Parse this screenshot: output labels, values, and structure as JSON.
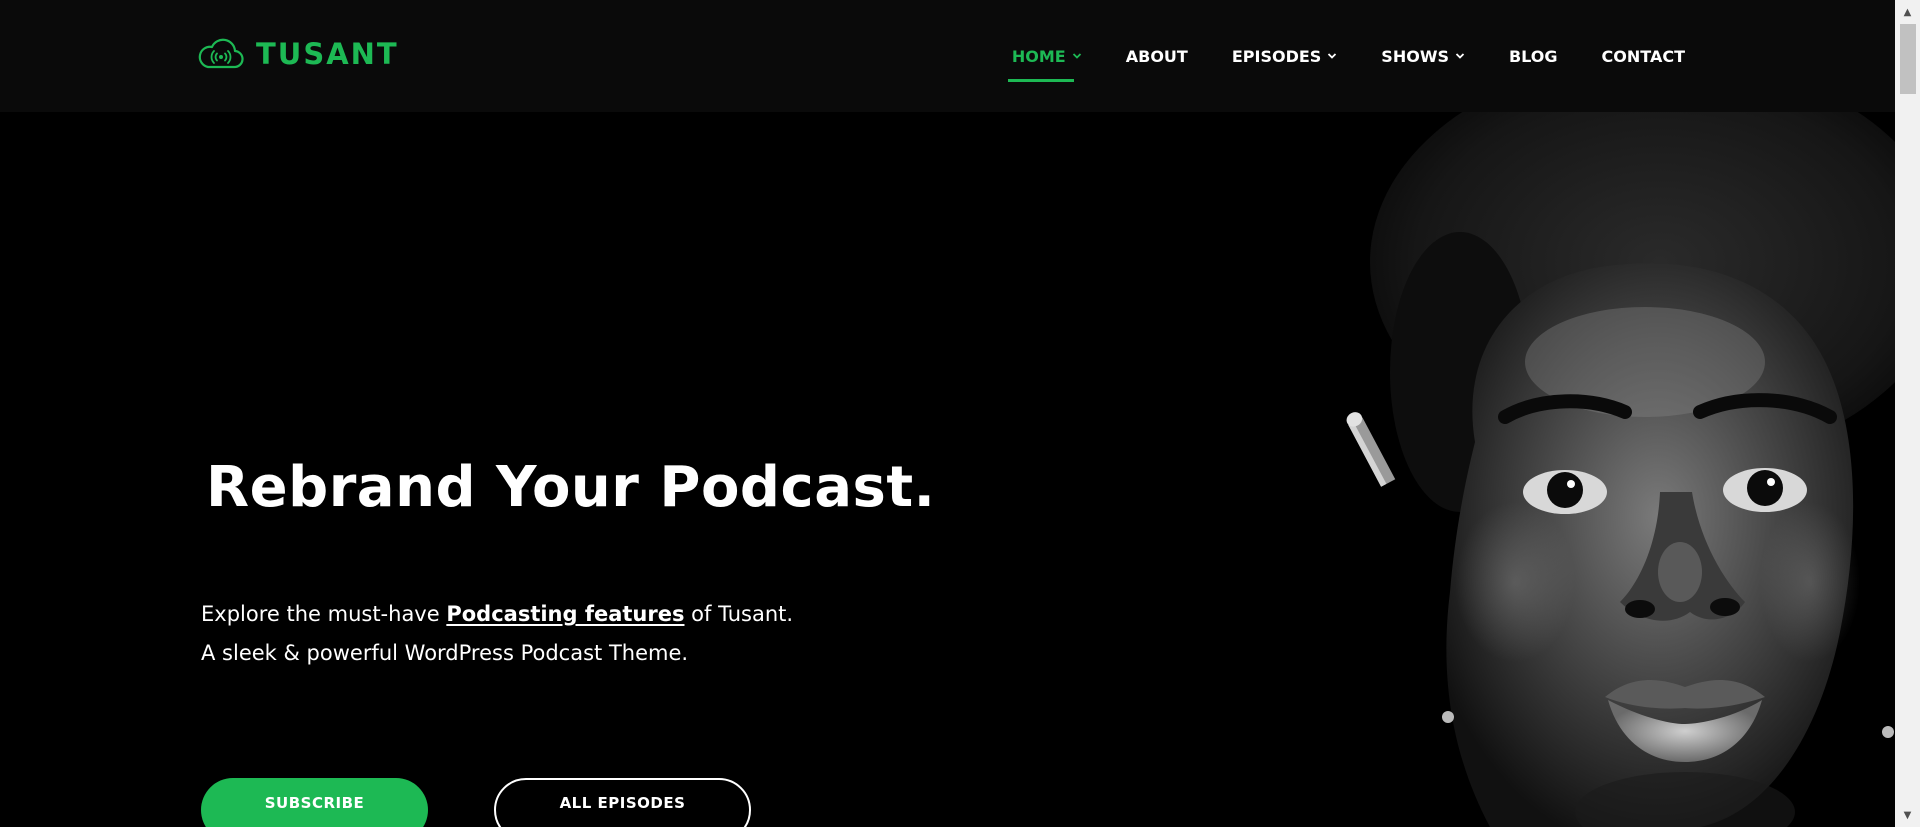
{
  "brand": {
    "name": "TUSANT",
    "color": "#1db954"
  },
  "nav": {
    "items": [
      {
        "label": "HOME",
        "has_dropdown": true,
        "active": true
      },
      {
        "label": "ABOUT",
        "has_dropdown": false,
        "active": false
      },
      {
        "label": "EPISODES",
        "has_dropdown": true,
        "active": false
      },
      {
        "label": "SHOWS",
        "has_dropdown": true,
        "active": false
      },
      {
        "label": "BLOG",
        "has_dropdown": false,
        "active": false
      },
      {
        "label": "CONTACT",
        "has_dropdown": false,
        "active": false
      }
    ]
  },
  "hero": {
    "title": "Rebrand Your Podcast.",
    "line1_before": "Explore the must-have ",
    "line1_link": "Podcasting features",
    "line1_after": " of Tusant.",
    "line2": "A sleek & powerful WordPress Podcast Theme.",
    "subscribe_label": "SUBSCRIBE",
    "episodes_label": "ALL EPISODES"
  },
  "colors": {
    "background": "#000000",
    "header": "#0a0a0a",
    "accent": "#1db954",
    "text": "#ffffff"
  },
  "icons": {
    "logo": "cloud-podcast-icon",
    "dropdown": "chevron-down-icon"
  }
}
